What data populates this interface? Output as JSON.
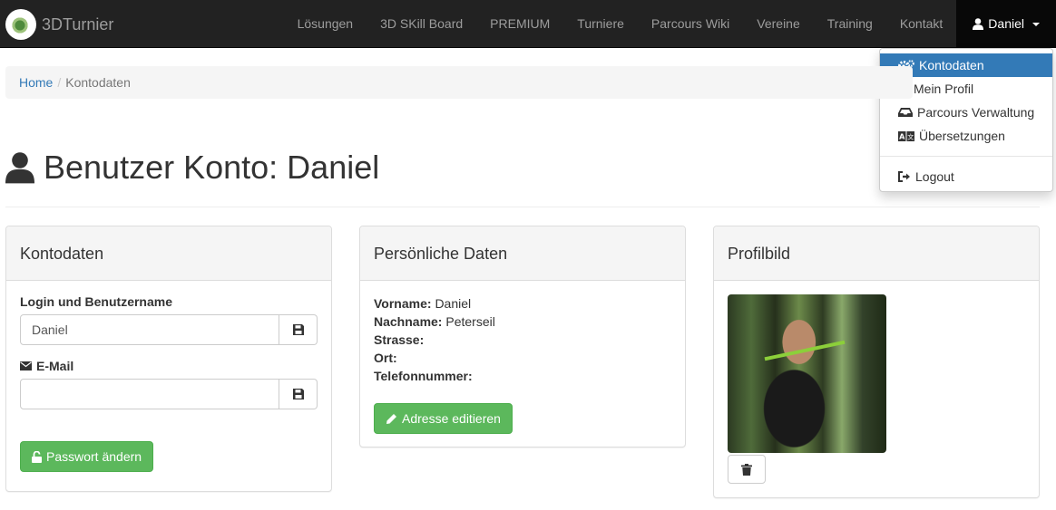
{
  "navbar": {
    "brand": "3DTurnier",
    "items": [
      {
        "label": "Lösungen"
      },
      {
        "label": "3D SKill Board"
      },
      {
        "label": "PREMIUM"
      },
      {
        "label": "Turniere"
      },
      {
        "label": "Parcours Wiki"
      },
      {
        "label": "Vereine"
      },
      {
        "label": "Training"
      },
      {
        "label": "Kontakt"
      }
    ],
    "user": "Daniel"
  },
  "dropdown": {
    "items": [
      {
        "label": "Kontodaten",
        "icon": "cogs-icon"
      },
      {
        "label": "Mein Profil",
        "icon": "user-icon"
      },
      {
        "label": "Parcours Verwaltung",
        "icon": "inbox-icon"
      },
      {
        "label": "Übersetzungen",
        "icon": "translate-icon"
      }
    ],
    "logout": "Logout"
  },
  "breadcrumb": {
    "home": "Home",
    "current": "Kontodaten"
  },
  "page": {
    "title": "Benutzer Konto: Daniel"
  },
  "account_panel": {
    "title": "Kontodaten",
    "login_label": "Login und Benutzername",
    "login_value": "Daniel",
    "email_label": "E-Mail",
    "email_value": "",
    "password_button": "Passwort ändern"
  },
  "personal_panel": {
    "title": "Persönliche Daten",
    "fields": [
      {
        "key": "Vorname:",
        "value": "Daniel"
      },
      {
        "key": "Nachname:",
        "value": "Peterseil"
      },
      {
        "key": "Strasse:",
        "value": ""
      },
      {
        "key": "Ort:",
        "value": ""
      },
      {
        "key": "Telefonnummer:",
        "value": ""
      }
    ],
    "edit_button": "Adresse editieren"
  },
  "photo_panel": {
    "title": "Profilbild"
  },
  "colors": {
    "primary": "#337ab7",
    "success": "#5cb85c",
    "navbar": "#222222"
  }
}
